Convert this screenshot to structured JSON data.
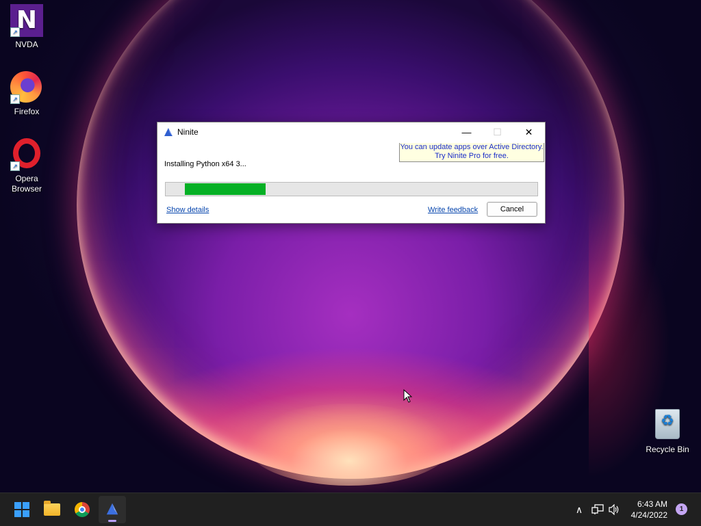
{
  "desktop": {
    "icons": [
      {
        "label": "NVDA",
        "icon": "nvda-icon"
      },
      {
        "label": "Firefox",
        "icon": "firefox-icon"
      },
      {
        "label": "Opera\nBrowser",
        "icon": "opera-icon"
      },
      {
        "label": "Recycle Bin",
        "icon": "recycle-bin-icon"
      }
    ],
    "nvda_logo_text": "N"
  },
  "dialog": {
    "title": "Ninite",
    "status": "Installing Python x64 3...",
    "progress_percent": 23,
    "promo_line1": "You can update apps over Active Directory.",
    "promo_line2": "Try Ninite Pro for free.",
    "show_details_label": "Show details",
    "write_feedback_label": "Write feedback",
    "cancel_label": "Cancel",
    "minimize_glyph": "—",
    "maximize_glyph": "☐",
    "close_glyph": "✕"
  },
  "taskbar": {
    "apps": [
      "start-icon",
      "file-explorer-icon",
      "chrome-icon",
      "ninite-icon"
    ],
    "tray": {
      "chevron": "∧",
      "network_icon": "network-icon",
      "volume_icon": "volume-icon",
      "time": "6:43 AM",
      "date": "4/24/2022",
      "notification_count": "1"
    }
  },
  "colors": {
    "progress_fill": "#06b025",
    "promo_bg": "#ffffe1",
    "promo_text": "#1a2cc8",
    "link": "#0645ad"
  }
}
